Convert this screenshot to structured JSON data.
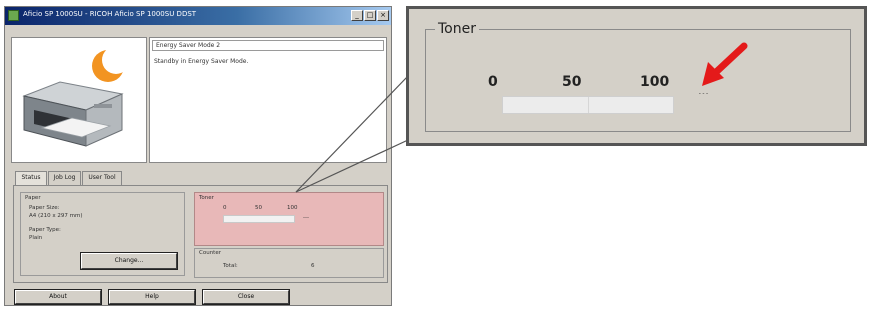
{
  "window": {
    "title": "Aficio SP 1000SU - RICOH Aficio SP 1000SU DDST",
    "controls": [
      "_",
      "□",
      "×"
    ]
  },
  "status_panel": {
    "mode": "Energy Saver Mode 2",
    "description": "Standby in Energy Saver Mode."
  },
  "tabs": [
    {
      "label": "Status"
    },
    {
      "label": "Job Log"
    },
    {
      "label": "User Tool"
    }
  ],
  "paper": {
    "group_label": "Paper",
    "size_label": "Paper Size:",
    "size_value": "A4 (210 x 297 mm)",
    "type_label": "Paper Type:",
    "type_value": "Plain",
    "change_button": "Change..."
  },
  "toner": {
    "group_label": "Toner",
    "ticks": [
      "0",
      "50",
      "100"
    ],
    "percent_text": "---",
    "level": 0
  },
  "counter": {
    "group_label": "Counter",
    "total_label": "Total:",
    "total_value": "6"
  },
  "footer": {
    "about": "About",
    "help": "Help",
    "close": "Close"
  },
  "callout": {
    "legend": "Toner",
    "ticks": [
      "0",
      "50",
      "100"
    ],
    "percent_text": "---",
    "arrow_color": "#e41a1a"
  },
  "colors": {
    "titlebar": "#0a246a",
    "toner_highlight": "#e8b8b8",
    "window_bg": "#d4d0c8"
  }
}
